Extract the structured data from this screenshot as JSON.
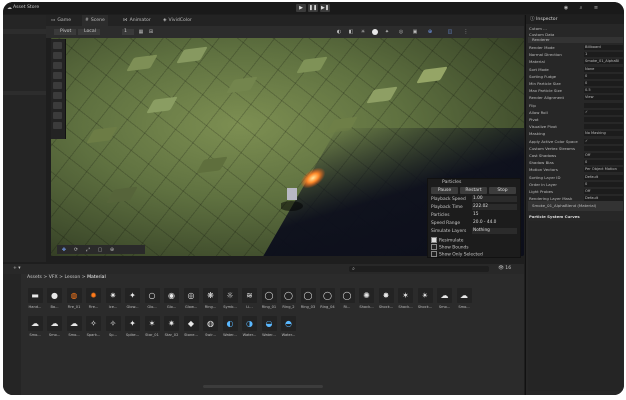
{
  "topbar": {
    "asset_store": "Asset Store",
    "play_icons": [
      "play-icon",
      "pause-icon",
      "step-icon"
    ]
  },
  "scene_tabs": [
    {
      "label": "Game",
      "icon": "game-icon"
    },
    {
      "label": "Scene",
      "icon": "scene-icon"
    },
    {
      "label": "Animator",
      "icon": "animator-icon"
    },
    {
      "label": "VividColor",
      "icon": "palette-icon"
    }
  ],
  "scene_toolbar": {
    "pivot": "Pivot",
    "local": "Local",
    "snap": "1"
  },
  "particles_panel": {
    "title": "Particles",
    "buttons": [
      "Pause",
      "Restart",
      "Stop"
    ],
    "rows": [
      {
        "label": "Playback Speed",
        "value": "1.00"
      },
      {
        "label": "Playback Time",
        "value": "222.02"
      },
      {
        "label": "Particles",
        "value": "15"
      },
      {
        "label": "Speed Range",
        "value": "20.0 - 44.0"
      },
      {
        "label": "Simulate Layers",
        "value": "Nothing"
      }
    ],
    "checks": [
      {
        "label": "Resimulate",
        "checked": true
      },
      {
        "label": "Show Bounds",
        "checked": false
      },
      {
        "label": "Show Only Selected",
        "checked": false
      }
    ]
  },
  "inspector": {
    "title": "Inspector",
    "header_rows": [
      "Cutom ...",
      "Custom Data",
      "Renderer"
    ],
    "rows": [
      {
        "label": "Render Mode",
        "value": "Billboard"
      },
      {
        "label": "Normal Direction",
        "value": "1"
      },
      {
        "label": "Material",
        "value": "Smoke_01_AlphaBl"
      },
      {
        "label": "Sort Mode",
        "value": "None"
      },
      {
        "label": "Sorting Fudge",
        "value": "0"
      },
      {
        "label": "Min Particle Size",
        "value": "0"
      },
      {
        "label": "Max Particle Size",
        "value": "0.5"
      },
      {
        "label": "Render Alignment",
        "value": "View"
      },
      {
        "label": "Flip",
        "value": ""
      },
      {
        "label": "Allow Roll",
        "value": "✓"
      },
      {
        "label": "Pivot",
        "value": ""
      },
      {
        "label": "Visualize Pivot",
        "value": ""
      },
      {
        "label": "Masking",
        "value": "No Masking"
      },
      {
        "label": "Apply Active Color Space",
        "value": "✓"
      },
      {
        "label": "Custom Vertex Streams",
        "value": ""
      },
      {
        "label": "Cast Shadows",
        "value": "Off"
      },
      {
        "label": "Shadow Bias",
        "value": "0"
      },
      {
        "label": "Motion Vectors",
        "value": "Per Object Motion"
      },
      {
        "label": "Sorting Layer ID",
        "value": "Default"
      },
      {
        "label": "Order in Layer",
        "value": "0"
      },
      {
        "label": "Light Probes",
        "value": "Off"
      },
      {
        "label": "Rendering Layer Mask",
        "value": "Default"
      }
    ],
    "material_name": "Smoke_01_AlphaBlend (Material)",
    "curves_title": "Particle System Curves"
  },
  "project": {
    "breadcrumb": [
      "Assets",
      "VFX",
      "Lesson",
      "Material"
    ],
    "count": "16",
    "row1": [
      "Hand...",
      "Ba...",
      "Fire_01",
      "Fire...",
      "Ice...",
      "Glow...",
      "Glo...",
      "Glo...",
      "Glow...",
      "Ring...",
      "Symb...",
      "Li...",
      "Ring_01",
      "Ring_2",
      "Ring_03",
      "Ring_04",
      "Ri...",
      "Shock...",
      "Shock...",
      "Shock...",
      "Shock...",
      "Smo...",
      "Smo..."
    ],
    "row2": [
      "Smo...",
      "Smo...",
      "Smo...",
      "Spark...",
      "Sp...",
      "Spike...",
      "Star_01",
      "Star_02",
      "Stone...",
      "Swir...",
      "Water...",
      "Water...",
      "Water...",
      "Water..."
    ]
  },
  "colors": {
    "accent": "#3a79d8",
    "fire": "#ff7a1a",
    "scene_grass": "#6f8048"
  }
}
